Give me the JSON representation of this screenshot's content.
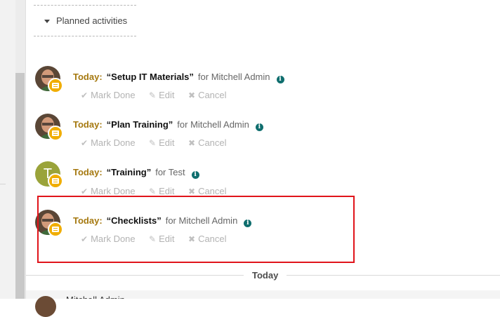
{
  "planned": {
    "label": "Planned activities"
  },
  "activities": [
    {
      "today": "Today:",
      "title": "“Setup IT Materials”",
      "for": "for Mitchell Admin",
      "avatar": "photo"
    },
    {
      "today": "Today:",
      "title": "“Plan Training”",
      "for": "for Mitchell Admin",
      "avatar": "photo"
    },
    {
      "today": "Today:",
      "title": "“Training”",
      "for": "for Test",
      "avatar": "letter",
      "avatar_letter": "T"
    },
    {
      "today": "Today:",
      "title": "“Checklists”",
      "for": "for Mitchell Admin",
      "avatar": "photo"
    }
  ],
  "actions": {
    "mark_done": "Mark Done",
    "edit": "Edit",
    "cancel": "Cancel"
  },
  "separator": {
    "label": "Today"
  },
  "next_entry": {
    "author": "Mitchell Admin"
  },
  "colors": {
    "today": "#a5780f",
    "badge": "#f0ad00",
    "info": "#0f6e6e",
    "highlight": "#e0141b",
    "letter_avatar": "#9aa33a"
  },
  "icons": {
    "caret": "caret-down-icon",
    "info": "info-circle-icon",
    "check": "check-icon",
    "pencil": "pencil-icon",
    "times": "times-icon",
    "badge": "activity-type-icon"
  }
}
